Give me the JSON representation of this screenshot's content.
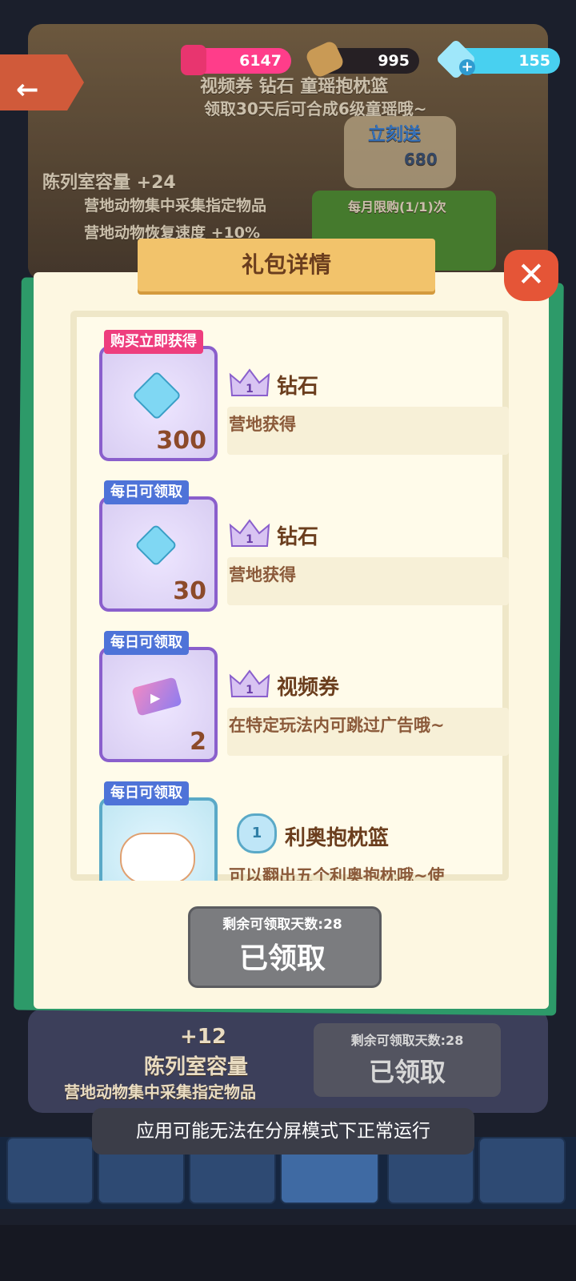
{
  "currency": {
    "pink": "6147",
    "wood": "995",
    "gem": "155"
  },
  "background": {
    "line1": "视频券        钻石        童瑶抱枕篮",
    "line2": "领取30天后可合成6级童瑶哦~",
    "send_label": "立刻送",
    "send_amount": "680",
    "monthly_limit": "每月限购(1/1)次",
    "capacity": "陈列室容量    +24",
    "bullet1": "营地动物集中采集指定物品",
    "bullet2": "营地动物恢复速度 +10%",
    "bottom_plus": "+12",
    "bottom_capacity": "陈列室容量",
    "bottom_bullet": "营地动物集中采集指定物品",
    "bottom_claim_sub": "剩余可领取天数:28",
    "bottom_claim_main": "已领取"
  },
  "dialog": {
    "title": "礼包详情",
    "close": "✕",
    "items": [
      {
        "badge": "购买立即获得",
        "qty": "300",
        "level": "1",
        "name": "钻石",
        "desc": "营地获得"
      },
      {
        "badge": "每日可领取",
        "qty": "30",
        "level": "1",
        "name": "钻石",
        "desc": "营地获得"
      },
      {
        "badge": "每日可领取",
        "qty": "2",
        "level": "1",
        "name": "视频券",
        "desc": "在特定玩法内可跳过广告哦~"
      },
      {
        "badge": "每日可领取",
        "qty": "",
        "level": "1",
        "name": "利奥抱枕篮",
        "desc": "可以翻出五个利奥抱枕哦~使"
      }
    ],
    "claim_sub": "剩余可领取天数:28",
    "claim_main": "已领取"
  },
  "toast": "应用可能无法在分屏模式下正常运行",
  "colors": {
    "accent_green": "#2d9a69",
    "panel": "#fdf7e1",
    "ribbon": "#f2c36b",
    "close": "#e55537"
  }
}
